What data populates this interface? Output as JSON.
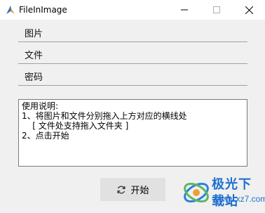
{
  "window": {
    "title": "FileInImage"
  },
  "fields": [
    {
      "label": "图片"
    },
    {
      "label": "文件"
    },
    {
      "label": "密码"
    }
  ],
  "instructions": {
    "lines": [
      "使用说明:",
      "1、将图片和文件分别拖入上方对应的横线处",
      "    [ 文件处支持拖入文件夹 ]",
      "2、点击开始"
    ]
  },
  "actions": {
    "start_label": "开始",
    "start_icon": "refresh-icon"
  },
  "watermark": {
    "title": "极光下载站",
    "url": "www.xz7.com",
    "color": "#1f6fd0"
  },
  "colors": {
    "window_bg": "#f0f0f0",
    "titlebar_bg": "#ffffff",
    "button_bg": "#e1e1e1"
  }
}
